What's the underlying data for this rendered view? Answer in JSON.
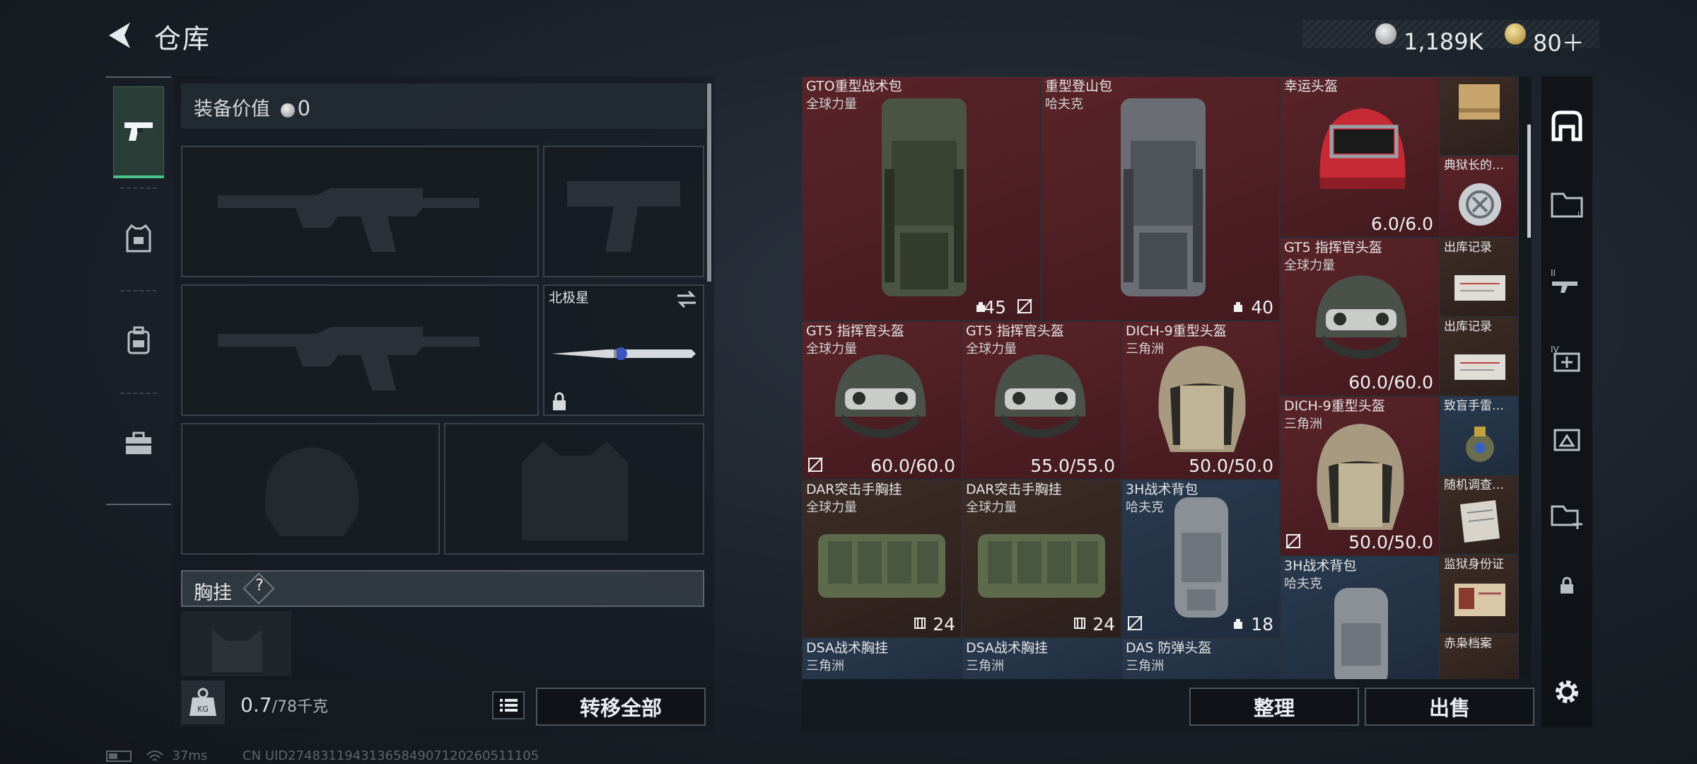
{
  "header": {
    "title": "仓库"
  },
  "currency": {
    "silver": "1,189K",
    "gold": "80＋"
  },
  "left": {
    "equip_value_label": "装备价值",
    "equip_value": "0",
    "melee_name": "北极星",
    "chest_rig_label": "胸挂",
    "help": "?",
    "weight": "0.7",
    "weight_max": "/78千克",
    "transfer_all": "转移全部"
  },
  "stash": {
    "items": [
      {
        "name": "GTO重型战术包",
        "sub": "全球力量",
        "value": "45",
        "kind": "bag-green"
      },
      {
        "name": "重型登山包",
        "sub": "哈夫克",
        "value": "40",
        "kind": "bag-gray"
      },
      {
        "name": "幸运头盔",
        "sub": "",
        "value": "6.0/6.0",
        "kind": "helmet-red"
      },
      {
        "name": "GT5 指挥官头盔",
        "sub": "全球力量",
        "value": "60.0/60.0",
        "kind": "helmet-gt5"
      },
      {
        "name": "GT5 指挥官头盔",
        "sub": "全球力量",
        "value": "55.0/55.0",
        "kind": "helmet-gt5"
      },
      {
        "name": "DICH-9重型头盔",
        "sub": "三角洲",
        "value": "50.0/50.0",
        "kind": "helmet-dich"
      },
      {
        "name": "GT5 指挥官头盔",
        "sub": "全球力量",
        "value": "60.0/60.0",
        "kind": "helmet-gt5"
      },
      {
        "name": "DAR突击手胸挂",
        "sub": "全球力量",
        "value": "24",
        "kind": "rig"
      },
      {
        "name": "DAR突击手胸挂",
        "sub": "全球力量",
        "value": "24",
        "kind": "rig"
      },
      {
        "name": "3H战术背包",
        "sub": "哈夫克",
        "value": "18",
        "kind": "pack"
      },
      {
        "name": "DICH-9重型头盔",
        "sub": "三角洲",
        "value": "50.0/50.0",
        "kind": "helmet-dich"
      },
      {
        "name": "3H战术背包",
        "sub": "哈夫克",
        "value": "",
        "kind": "pack"
      },
      {
        "name": "DSA战术胸挂",
        "sub": "三角洲",
        "value": "",
        "kind": "rig"
      },
      {
        "name": "DSA战术胸挂",
        "sub": "三角洲",
        "value": "",
        "kind": "rig"
      },
      {
        "name": "DAS 防弹头盔",
        "sub": "三角洲",
        "value": "",
        "kind": "helmet-dich"
      }
    ],
    "small": [
      "",
      "典狱长的…",
      "出库记录",
      "出库记录",
      "致盲手雷…",
      "随机调查…",
      "监狱身份证",
      "赤枭档案"
    ]
  },
  "footer": {
    "sort": "整理",
    "sell": "出售"
  },
  "status": {
    "ping": "37ms",
    "uid": "CN UID2748311943136584907120260511105"
  }
}
